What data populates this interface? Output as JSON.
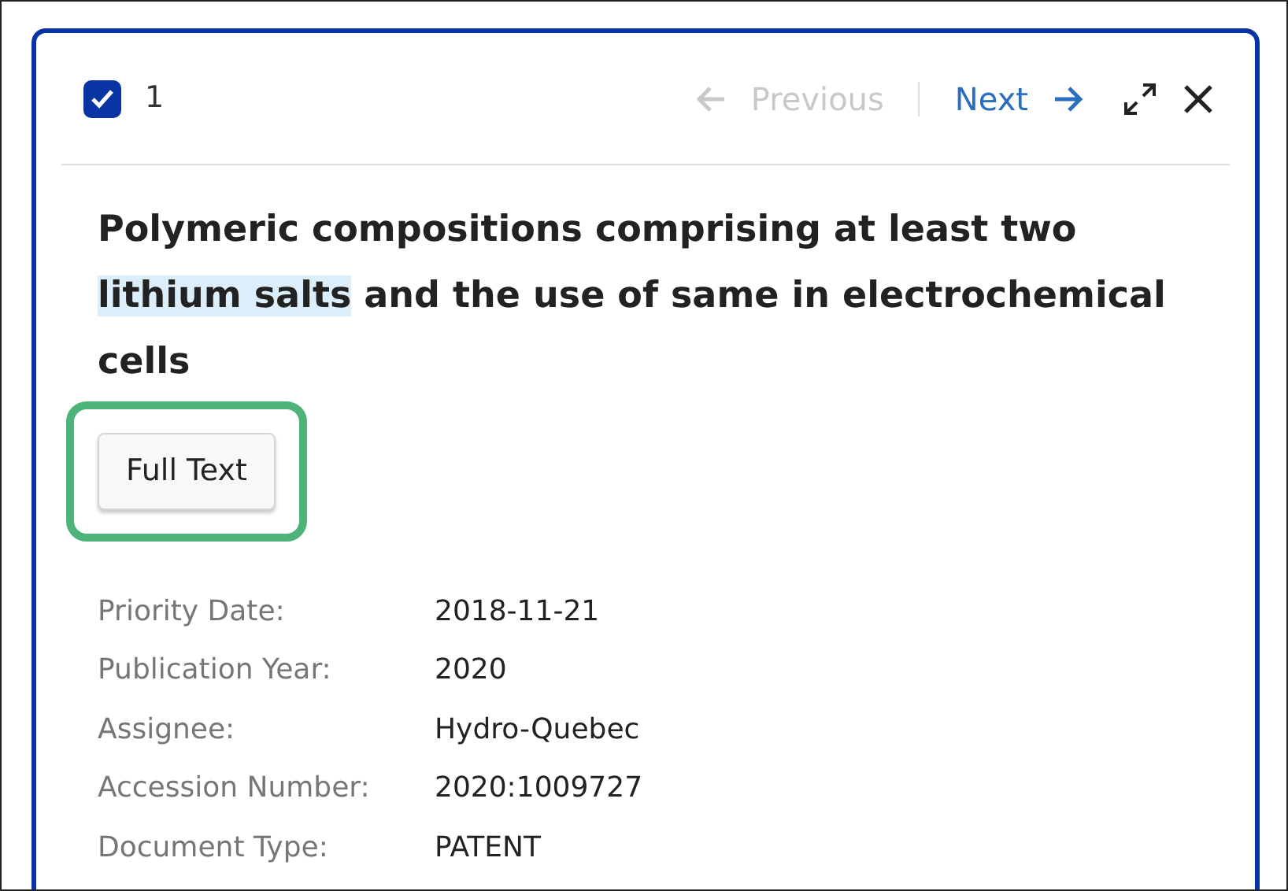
{
  "selection": {
    "checked": true,
    "count": "1"
  },
  "navigation": [
    {
      "kind": "previous",
      "label": "Previous",
      "disabled": true
    },
    {
      "kind": "next",
      "label": "Next",
      "disabled": false
    }
  ],
  "title_parts": [
    {
      "text": "Polymeric compositions comprising at least two ",
      "highlighted": false
    },
    {
      "text": "lithium salts",
      "highlighted": true
    },
    {
      "text": " and the use of same in electrochemical cells",
      "highlighted": false
    }
  ],
  "full_text_button": {
    "label": "Full Text",
    "highlighted": true
  },
  "details": [
    {
      "label": "Priority Date:",
      "value": "2018-11-21"
    },
    {
      "label": "Publication Year:",
      "value": "2020"
    },
    {
      "label": "Assignee:",
      "value": "Hydro-Quebec"
    },
    {
      "label": "Accession Number:",
      "value": "2020:1009727"
    },
    {
      "label": "Document Type:",
      "value": "PATENT"
    }
  ]
}
